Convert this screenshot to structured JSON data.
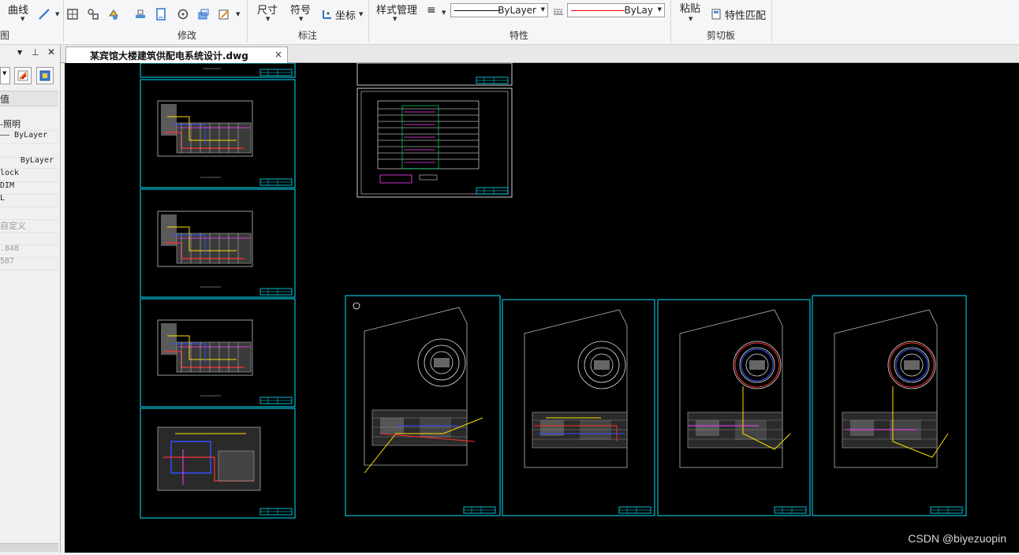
{
  "ribbon": {
    "draw_group_label": "图",
    "curve_label": "曲线",
    "modify_group_label": "修改",
    "dimension_label": "尺寸",
    "symbol_label": "符号",
    "coordinate_label": "坐标",
    "annotation_group_label": "标注",
    "style_manager_label": "样式管理",
    "linetype_value": "ByLayer",
    "color_value": "ByLay",
    "properties_group_label": "特性",
    "paste_label": "粘贴",
    "match_properties_label": "特性匹配",
    "clipboard_group_label": "剪切板",
    "colors": {
      "color_swatch": "#ff0000"
    }
  },
  "left_panel": {
    "header_value": "值",
    "rows": [
      "-照明",
      "—— ByLayer",
      "",
      "ByLayer",
      "lock",
      "DIM",
      "L",
      "",
      "自定义",
      "",
      ".848",
      "587"
    ]
  },
  "tab": {
    "filename": "某宾馆大楼建筑供配电系统设计.dwg",
    "close_glyph": "×"
  },
  "canvas": {
    "watermark": "CSDN @biyezuopin",
    "colors": {
      "background": "#000000",
      "frame": "#00e5ff"
    }
  }
}
